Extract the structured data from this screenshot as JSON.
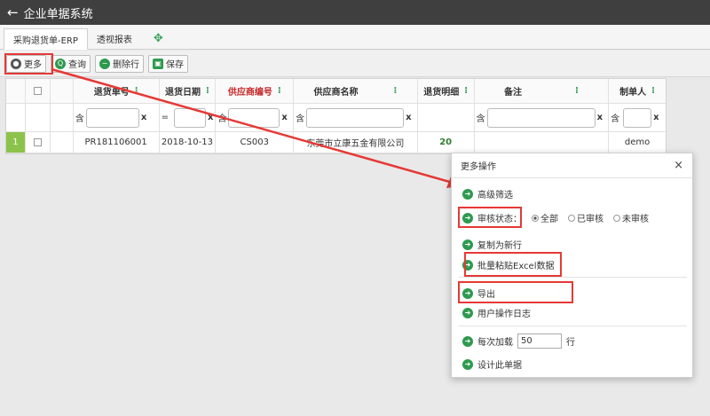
{
  "app": {
    "title": "企业单据系统"
  },
  "tabs": [
    {
      "label": "采购退货单-ERP"
    },
    {
      "label": "透视报表"
    }
  ],
  "toolbar": {
    "more": "更多",
    "query": "查询",
    "delete_row": "删除行",
    "save": "保存"
  },
  "grid": {
    "headers": {
      "return_no": "退货单号",
      "return_date": "退货日期",
      "supplier_code": "供应商编号",
      "supplier_name": "供应商名称",
      "return_detail": "退货明细",
      "remark": "备注",
      "creator": "制单人"
    },
    "filters": {
      "return_no_op": "含",
      "return_date_op": "=",
      "supplier_code_op": "含",
      "supplier_name_op": "含",
      "remark_op": "含",
      "creator_op": "含",
      "clear": "x"
    },
    "rows": [
      {
        "index": "1",
        "return_no": "PR181106001",
        "return_date": "2018-10-13",
        "supplier_code": "CS003",
        "supplier_name": "东莞市立康五金有限公司",
        "return_detail": "20",
        "remark": "",
        "creator": "demo"
      }
    ]
  },
  "modal": {
    "title": "更多操作",
    "close": "×",
    "advanced_filter": "高级筛选",
    "audit_label": "审核状态：",
    "audit_options": [
      "全部",
      "已审核",
      "未审核"
    ],
    "copy_new": "复制为新行",
    "paste_excel": "批量粘贴Excel数据",
    "export": "导出",
    "user_log": "用户操作日志",
    "load_label": "每次加载",
    "load_value": "50",
    "load_unit": "行",
    "design": "设计此单据"
  },
  "colors": {
    "accent": "#2e9a4f",
    "annotation": "#e53935",
    "topbar": "#3f3f3f"
  }
}
